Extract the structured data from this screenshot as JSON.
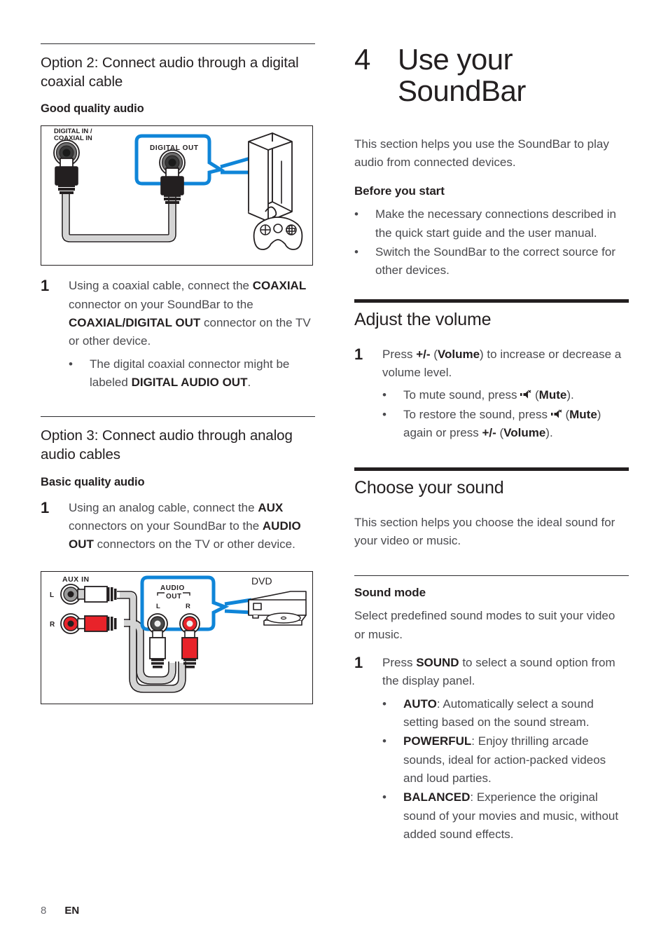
{
  "page": {
    "number": "8",
    "language": "EN"
  },
  "left_column": {
    "option2": {
      "heading": "Option 2: Connect audio through a digital coaxial cable",
      "quality_caption": "Good quality audio",
      "figure": {
        "name": "coaxial-connection-diagram",
        "label_soundbar_line1": "DIGITAL IN /",
        "label_soundbar_line2": "COAXIAL IN",
        "label_device": "DIGITAL OUT",
        "accent_color": "#0f85d8"
      },
      "step1": {
        "number": "1",
        "text_parts": [
          {
            "t": "Using a coaxial cable, connect the ",
            "b": false
          },
          {
            "t": "COAXIAL",
            "b": true
          },
          {
            "t": " connector on your SoundBar to the ",
            "b": false
          },
          {
            "t": "COAXIAL/DIGITAL OUT",
            "b": true
          },
          {
            "t": " connector on the TV or other device.",
            "b": false
          }
        ],
        "bullets": [
          [
            {
              "t": "The digital coaxial connector might be labeled ",
              "b": false
            },
            {
              "t": "DIGITAL AUDIO OUT",
              "b": true
            },
            {
              "t": ".",
              "b": false
            }
          ]
        ]
      }
    },
    "option3": {
      "heading": "Option 3: Connect audio through analog audio cables",
      "quality_caption": "Basic quality audio",
      "step1": {
        "number": "1",
        "text_parts": [
          {
            "t": "Using an analog cable, connect the ",
            "b": false
          },
          {
            "t": "AUX",
            "b": true
          },
          {
            "t": " connectors on your SoundBar to the ",
            "b": false
          },
          {
            "t": "AUDIO OUT",
            "b": true
          },
          {
            "t": " connectors on the TV or other device.",
            "b": false
          }
        ]
      },
      "figure": {
        "name": "analog-audio-connection-diagram",
        "label_soundbar": "AUX IN",
        "label_left": "L",
        "label_right": "R",
        "label_device_line1": "AUDIO",
        "label_device_line2": "OUT",
        "label_device_left": "L",
        "label_device_right": "R",
        "label_device_name": "DVD",
        "accent_color": "#0f85d8",
        "right_channel_color": "#e8232a"
      }
    }
  },
  "right_column": {
    "chapter": {
      "number": "4",
      "title_line1": "Use your",
      "title_line2": "SoundBar"
    },
    "intro": "This section helps you use the SoundBar to play audio from connected devices.",
    "before_you_start": {
      "heading": "Before you start",
      "bullets": [
        [
          {
            "t": "Make the necessary connections described in the quick start guide and the user manual.",
            "b": false
          }
        ],
        [
          {
            "t": "Switch the SoundBar to the correct source for other devices.",
            "b": false
          }
        ]
      ]
    },
    "adjust_volume": {
      "heading": "Adjust the volume",
      "step1": {
        "number": "1",
        "text_parts": [
          {
            "t": "Press ",
            "b": false
          },
          {
            "t": "+/-",
            "b": true
          },
          {
            "t": " (",
            "b": false
          },
          {
            "t": "Volume",
            "b": true
          },
          {
            "t": ") to increase or decrease a volume level.",
            "b": false
          }
        ],
        "bullets": [
          [
            {
              "t": "To mute sound, press ",
              "b": false
            },
            {
              "icon": "mute-icon"
            },
            {
              "t": " (",
              "b": false
            },
            {
              "t": "Mute",
              "b": true
            },
            {
              "t": ").",
              "b": false
            }
          ],
          [
            {
              "t": "To restore the sound, press ",
              "b": false
            },
            {
              "icon": "mute-icon"
            },
            {
              "t": " (",
              "b": false
            },
            {
              "t": "Mute",
              "b": true
            },
            {
              "t": ") again or press ",
              "b": false
            },
            {
              "t": "+/-",
              "b": true
            },
            {
              "t": " (",
              "b": false
            },
            {
              "t": "Volume",
              "b": true
            },
            {
              "t": ").",
              "b": false
            }
          ]
        ]
      }
    },
    "choose_sound": {
      "heading": "Choose your sound",
      "intro": "This section helps you choose the ideal sound for your video or music.",
      "sound_mode": {
        "heading": "Sound mode",
        "intro": "Select predefined sound modes to suit your video or music.",
        "step1": {
          "number": "1",
          "text_parts": [
            {
              "t": "Press ",
              "b": false
            },
            {
              "t": "SOUND",
              "b": true
            },
            {
              "t": " to select a sound option from the display panel.",
              "b": false
            }
          ],
          "bullets": [
            [
              {
                "t": "AUTO",
                "b": true
              },
              {
                "t": ": Automatically select a sound setting based on the sound stream.",
                "b": false
              }
            ],
            [
              {
                "t": "POWERFUL",
                "b": true
              },
              {
                "t": ": Enjoy thrilling arcade sounds, ideal for action-packed videos and loud parties.",
                "b": false
              }
            ],
            [
              {
                "t": "BALANCED",
                "b": true
              },
              {
                "t": ": Experience the original sound of your movies and music, without added sound effects.",
                "b": false
              }
            ]
          ]
        }
      }
    }
  }
}
